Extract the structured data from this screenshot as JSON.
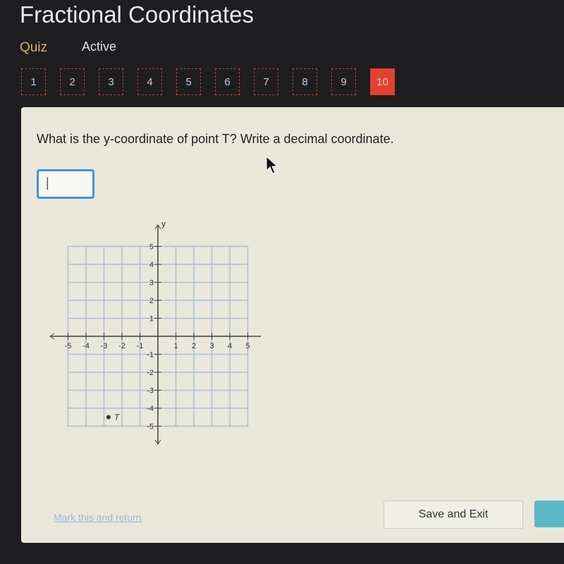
{
  "header": {
    "title": "Fractional Coordinates",
    "type": "Quiz",
    "status": "Active"
  },
  "nav": {
    "items": [
      "1",
      "2",
      "3",
      "4",
      "5",
      "6",
      "7",
      "8",
      "9",
      "10"
    ],
    "active": "10"
  },
  "question": {
    "text": "What is the y-coordinate of point T? Write a decimal coordinate.",
    "answer_value": "|"
  },
  "footer": {
    "mark_label": "Mark this and return",
    "save_label": "Save and Exit"
  },
  "colors": {
    "active_nav": "#e0422f",
    "input_border": "#4a8fd8",
    "grid": "#a9bfd6"
  },
  "chart_data": {
    "type": "scatter",
    "xlabel": "x",
    "ylabel": "y",
    "xlim": [
      -5,
      5
    ],
    "ylim": [
      -5,
      5
    ],
    "x_ticks": [
      "-5",
      "-4",
      "-3",
      "-2",
      "-1",
      "1",
      "2",
      "3",
      "4",
      "5"
    ],
    "y_ticks": [
      "5",
      "4",
      "3",
      "2",
      "1",
      "-1",
      "-2",
      "-3",
      "-4",
      "-5"
    ],
    "grid": true,
    "points": [
      {
        "label": "T",
        "x": -2.75,
        "y": -4.5
      }
    ]
  }
}
